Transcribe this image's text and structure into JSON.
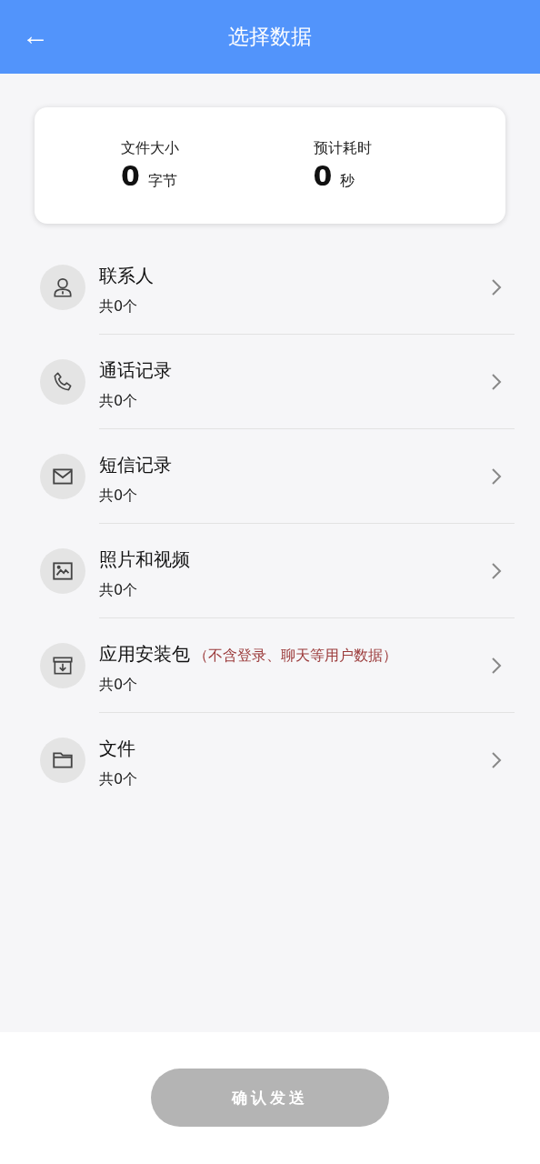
{
  "header": {
    "back_symbol": "←",
    "title": "选择数据"
  },
  "summary": [
    {
      "label": "文件大小",
      "value": "0",
      "unit": "字节"
    },
    {
      "label": "预计耗时",
      "value": "0",
      "unit": "秒"
    }
  ],
  "items": [
    {
      "kind": "contacts",
      "title": "联系人",
      "count": "共0个"
    },
    {
      "kind": "calls",
      "title": "通话记录",
      "count": "共0个"
    },
    {
      "kind": "sms",
      "title": "短信记录",
      "count": "共0个"
    },
    {
      "kind": "media",
      "title": "照片和视频",
      "count": "共0个"
    },
    {
      "kind": "apps",
      "title": "应用安装包",
      "note": "（不含登录、聊天等用户数据）",
      "count": "共0个"
    },
    {
      "kind": "files",
      "title": "文件",
      "count": "共0个"
    }
  ],
  "confirm_button": {
    "label": "确认发送",
    "disabled": true
  }
}
